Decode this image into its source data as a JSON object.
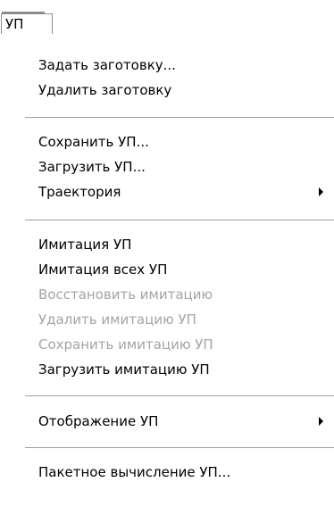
{
  "menubar": {
    "title": "УП"
  },
  "menu": {
    "items": [
      {
        "label": "Задать заготовку...",
        "enabled": true
      },
      {
        "label": "Удалить заготовку",
        "enabled": true
      },
      {
        "label": "Сохранить УП...",
        "enabled": true
      },
      {
        "label": "Загрузить УП...",
        "enabled": true
      },
      {
        "label": "Траектория",
        "enabled": true,
        "submenu": true
      },
      {
        "label": "Имитация УП",
        "enabled": true
      },
      {
        "label": "Имитация всех УП",
        "enabled": true
      },
      {
        "label": "Восстановить имитацию",
        "enabled": false
      },
      {
        "label": "Удалить имитацию УП",
        "enabled": false
      },
      {
        "label": "Сохранить имитацию УП",
        "enabled": false
      },
      {
        "label": "Загрузить имитацию УП",
        "enabled": true
      },
      {
        "label": "Отображение УП",
        "enabled": true,
        "submenu": true
      },
      {
        "label": "Пакетное вычисление УП...",
        "enabled": true
      }
    ]
  },
  "colors": {
    "text": "#000000",
    "disabled_text": "#a4a4a4",
    "separator": "#a0a0a0",
    "background": "#ffffff"
  }
}
